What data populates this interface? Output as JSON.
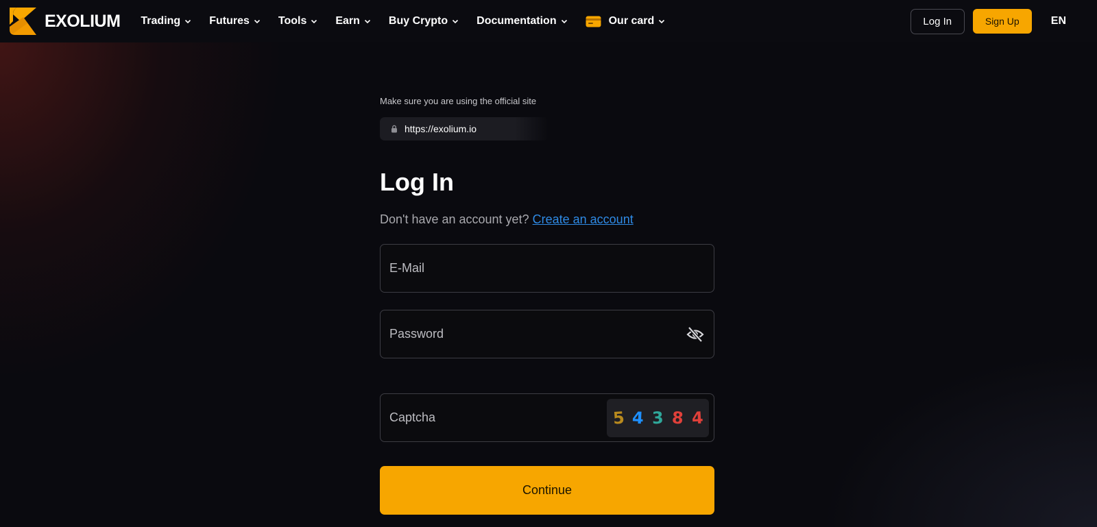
{
  "brand": {
    "name": "EXOLIUM",
    "accent": "#f7a600",
    "logo_icon": "exolium-logo-icon"
  },
  "nav": {
    "items": [
      {
        "label": "Trading",
        "icon": "chevron-down-icon"
      },
      {
        "label": "Futures",
        "icon": "chevron-down-icon"
      },
      {
        "label": "Tools",
        "icon": "chevron-down-icon"
      },
      {
        "label": "Earn",
        "icon": "chevron-down-icon"
      },
      {
        "label": "Buy Crypto",
        "icon": "chevron-down-icon"
      },
      {
        "label": "Documentation",
        "icon": "chevron-down-icon"
      },
      {
        "label": "Our card",
        "icon": "chevron-down-icon",
        "leading_icon": "credit-card-icon"
      }
    ],
    "login_label": "Log In",
    "signup_label": "Sign Up",
    "language": "EN"
  },
  "security": {
    "note": "Make sure you are using the official site",
    "url": "https://exolium.io"
  },
  "form": {
    "title": "Log In",
    "subtitle": "Don't have an account yet?",
    "create_link": "Create an account",
    "email_placeholder": "E-Mail",
    "password_placeholder": "Password",
    "captcha_placeholder": "Captcha",
    "captcha_digits": [
      "5",
      "4",
      "3",
      "8",
      "4"
    ],
    "continue_label": "Continue"
  }
}
